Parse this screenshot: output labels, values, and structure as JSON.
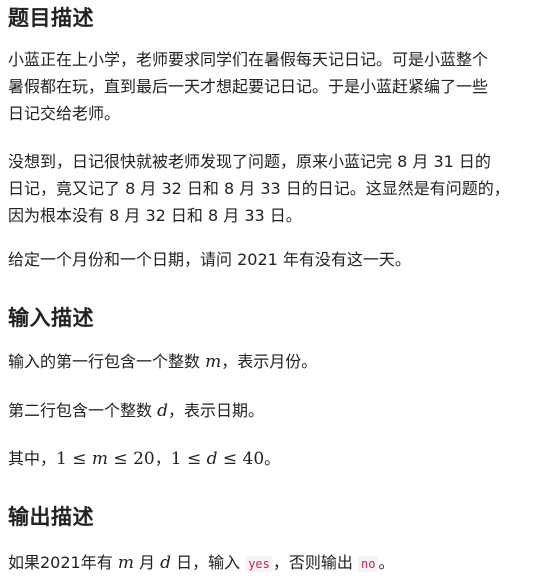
{
  "sections": {
    "problem": {
      "heading": "题目描述",
      "para1_line1": "小蓝正在上小学，老师要求同学们在暑假每天记日记。可是小蓝整个",
      "para1_line2": "暑假都在玩，直到最后一天才想起要记日记。于是小蓝赶紧编了一些",
      "para1_line3": "日记交给老师。",
      "para2_line1": "没想到，日记很快就被老师发现了问题，原来小蓝记完 8 月 31 日的",
      "para2_line2": "日记，竟又记了 8 月 32 日和 8 月 33 日的日记。这显然是有问题的，",
      "para2_line3": "因为根本没有 8 月 32 日和 8 月 33 日。",
      "para3": "给定一个月份和一个日期，请问 2021 年有没有这一天。"
    },
    "input": {
      "heading": "输入描述",
      "line1_pre": "输入的第一行包含一个整数 ",
      "line1_var": "m",
      "line1_post": "，表示月份。",
      "line2_pre": "第二行包含一个整数 ",
      "line2_var": "d",
      "line2_post": "，表示日期。",
      "line3_pre": "其中，",
      "line3_math1": "1 ≤ ",
      "line3_var1": "m",
      "line3_math1b": " ≤ 20",
      "line3_sep": "，",
      "line3_math2": "1 ≤ ",
      "line3_var2": "d",
      "line3_math2b": " ≤ 40",
      "line3_post": "。"
    },
    "output": {
      "heading": "输出描述",
      "line_pre": "如果2021年有 ",
      "line_var1": "m",
      "line_mid1": " 月 ",
      "line_var2": "d",
      "line_mid2": " 日，输入 ",
      "code_yes": "yes",
      "line_mid3": "，否则输出 ",
      "code_no": "no",
      "line_post": "。"
    }
  }
}
